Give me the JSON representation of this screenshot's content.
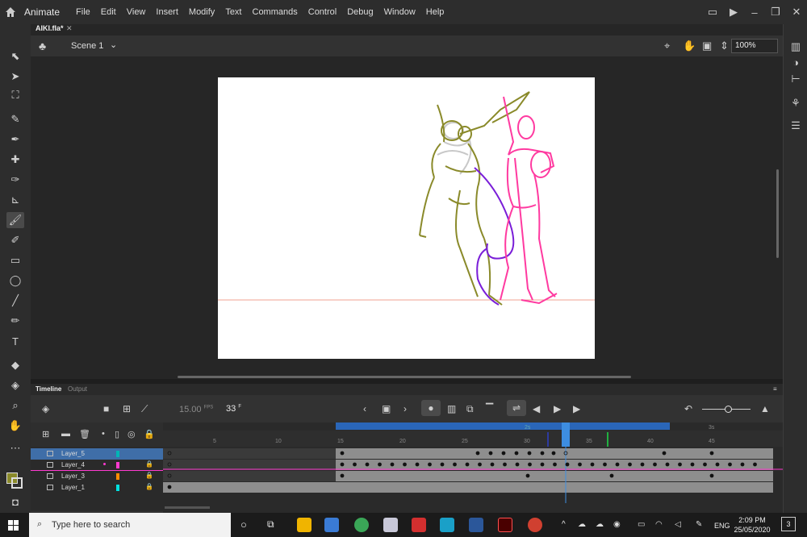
{
  "app": {
    "name": "Animate",
    "menus": [
      "File",
      "Edit",
      "View",
      "Insert",
      "Modify",
      "Text",
      "Commands",
      "Control",
      "Debug",
      "Window",
      "Help"
    ]
  },
  "document": {
    "tab": "AIKI.fla*",
    "scene": "Scene 1",
    "zoom": "100%"
  },
  "timeline": {
    "tabs": [
      "Timeline",
      "Output"
    ],
    "fps": "15.00",
    "fps_unit": "FPS",
    "current_frame": "33",
    "frame_unit": "F",
    "ruler_labels": [
      "5",
      "10",
      "15",
      "20",
      "25",
      "30",
      "35",
      "40",
      "45"
    ],
    "second_labels": [
      "2s",
      "3s"
    ],
    "layers": [
      {
        "name": "Layer_5",
        "color": "#00b5b5",
        "selected": true,
        "locked": false
      },
      {
        "name": "Layer_4",
        "color": "#ff3ad0",
        "selected": false,
        "locked": true
      },
      {
        "name": "Layer_3",
        "color": "#ff8c00",
        "selected": false,
        "locked": true
      },
      {
        "name": "Layer_1",
        "color": "#00e0e0",
        "selected": false,
        "locked": true
      }
    ]
  },
  "taskbar": {
    "search_placeholder": "Type here to search",
    "language": "ENG",
    "time": "2:09 PM",
    "date": "25/05/2020",
    "notification_count": "3"
  },
  "colors": {
    "stroke_color": "#8a8a2a",
    "accent": "#2d8ceb",
    "onion_outline": "#ff3ad0"
  }
}
